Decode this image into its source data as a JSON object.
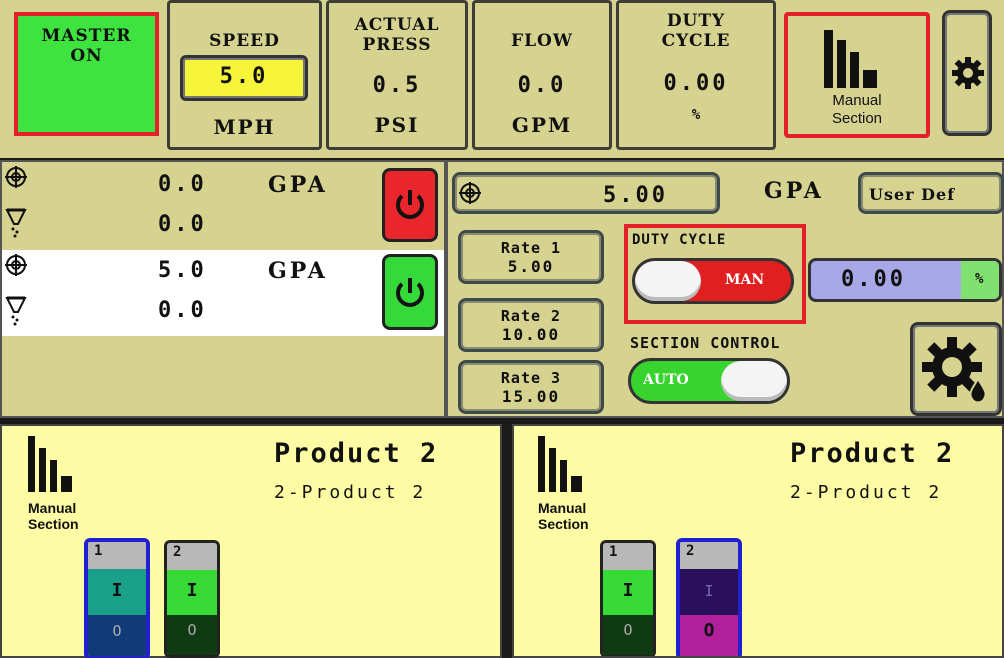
{
  "header": {
    "master": {
      "line1": "MASTER",
      "line2": "ON",
      "color": "#3fe33f"
    },
    "speed": {
      "label": "SPEED",
      "value": "5.0",
      "unit": "MPH"
    },
    "actual_press": {
      "label1": "ACTUAL",
      "label2": "PRESS",
      "value": "0.5",
      "unit": "PSI"
    },
    "flow": {
      "label": "FLOW",
      "value": "0.0",
      "unit": "GPM"
    },
    "duty_cycle": {
      "label1": "DUTY",
      "label2": "CYCLE",
      "value": "0.00",
      "unit": "%"
    },
    "manual_section": {
      "line1": "Manual",
      "line2": "Section"
    }
  },
  "products": [
    {
      "rate": "0.0",
      "rate_unit": "GPA",
      "flow": "0.0",
      "power": "off",
      "power_color": "#e8262c"
    },
    {
      "rate": "5.0",
      "rate_unit": "GPA",
      "flow": "0.0",
      "power": "on",
      "power_color": "#35d93a"
    }
  ],
  "control": {
    "target_rate": "5.00",
    "target_unit": "GPA",
    "user_def": "User Def",
    "rates": [
      {
        "label": "Rate 1",
        "value": "5.00"
      },
      {
        "label": "Rate 2",
        "value": "10.00"
      },
      {
        "label": "Rate 3",
        "value": "15.00"
      }
    ],
    "duty_cycle_title": "DUTY CYCLE",
    "duty_cycle_mode": "MAN",
    "duty_cycle_value": "0.00",
    "duty_cycle_unit": "%",
    "section_control_title": "SECTION CONTROL",
    "section_control_mode": "AUTO"
  },
  "section_panels": [
    {
      "title": "Product 2",
      "subtitle": "2-Product 2",
      "manual_line1": "Manual",
      "manual_line2": "Section",
      "switches": [
        {
          "number": "1",
          "state": "on",
          "selected": true,
          "on_label": "I",
          "off_label": "O"
        },
        {
          "number": "2",
          "state": "on",
          "selected": false,
          "on_label": "I",
          "off_label": "O"
        }
      ]
    },
    {
      "title": "Product 2",
      "subtitle": "2-Product 2",
      "manual_line1": "Manual",
      "manual_line2": "Section",
      "switches": [
        {
          "number": "1",
          "state": "on",
          "selected": false,
          "on_label": "I",
          "off_label": "O"
        },
        {
          "number": "2",
          "state": "off",
          "selected": true,
          "on_label": "I",
          "off_label": "O"
        }
      ]
    }
  ]
}
